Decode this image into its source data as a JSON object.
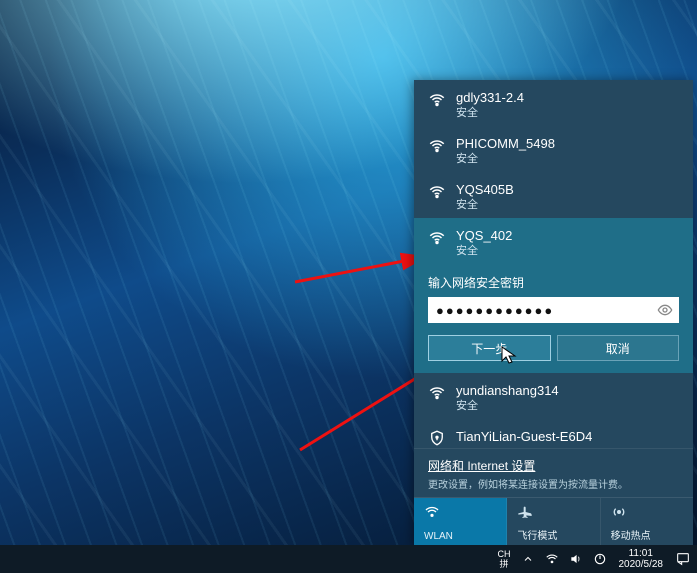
{
  "networks": [
    {
      "ssid": "gdly331-2.4",
      "status": "安全",
      "icon": "wifi-secure"
    },
    {
      "ssid": "PHICOMM_5498",
      "status": "安全",
      "icon": "wifi-secure"
    },
    {
      "ssid": "YQS405B",
      "status": "安全",
      "icon": "wifi-secure"
    },
    {
      "ssid": "YQS_402",
      "status": "安全",
      "icon": "wifi-secure",
      "selected": true
    },
    {
      "ssid": "yundianshang314",
      "status": "安全",
      "icon": "wifi-secure"
    },
    {
      "ssid": "TianYiLian-Guest-E6D4",
      "status": "",
      "icon": "wifi-open"
    }
  ],
  "connect": {
    "prompt": "输入网络安全密钥",
    "password_mask": "●●●●●●●●●●●●",
    "next": "下一步",
    "cancel": "取消"
  },
  "settings": {
    "link": "网络和 Internet 设置",
    "hint": "更改设置，例如将某连接设置为按流量计费。"
  },
  "tiles": {
    "wlan": "WLAN",
    "airplane": "飞行模式",
    "hotspot": "移动热点"
  },
  "taskbar": {
    "lang_top": "CH",
    "lang_bottom": "拼",
    "time": "11:01",
    "date": "2020/5/28"
  }
}
